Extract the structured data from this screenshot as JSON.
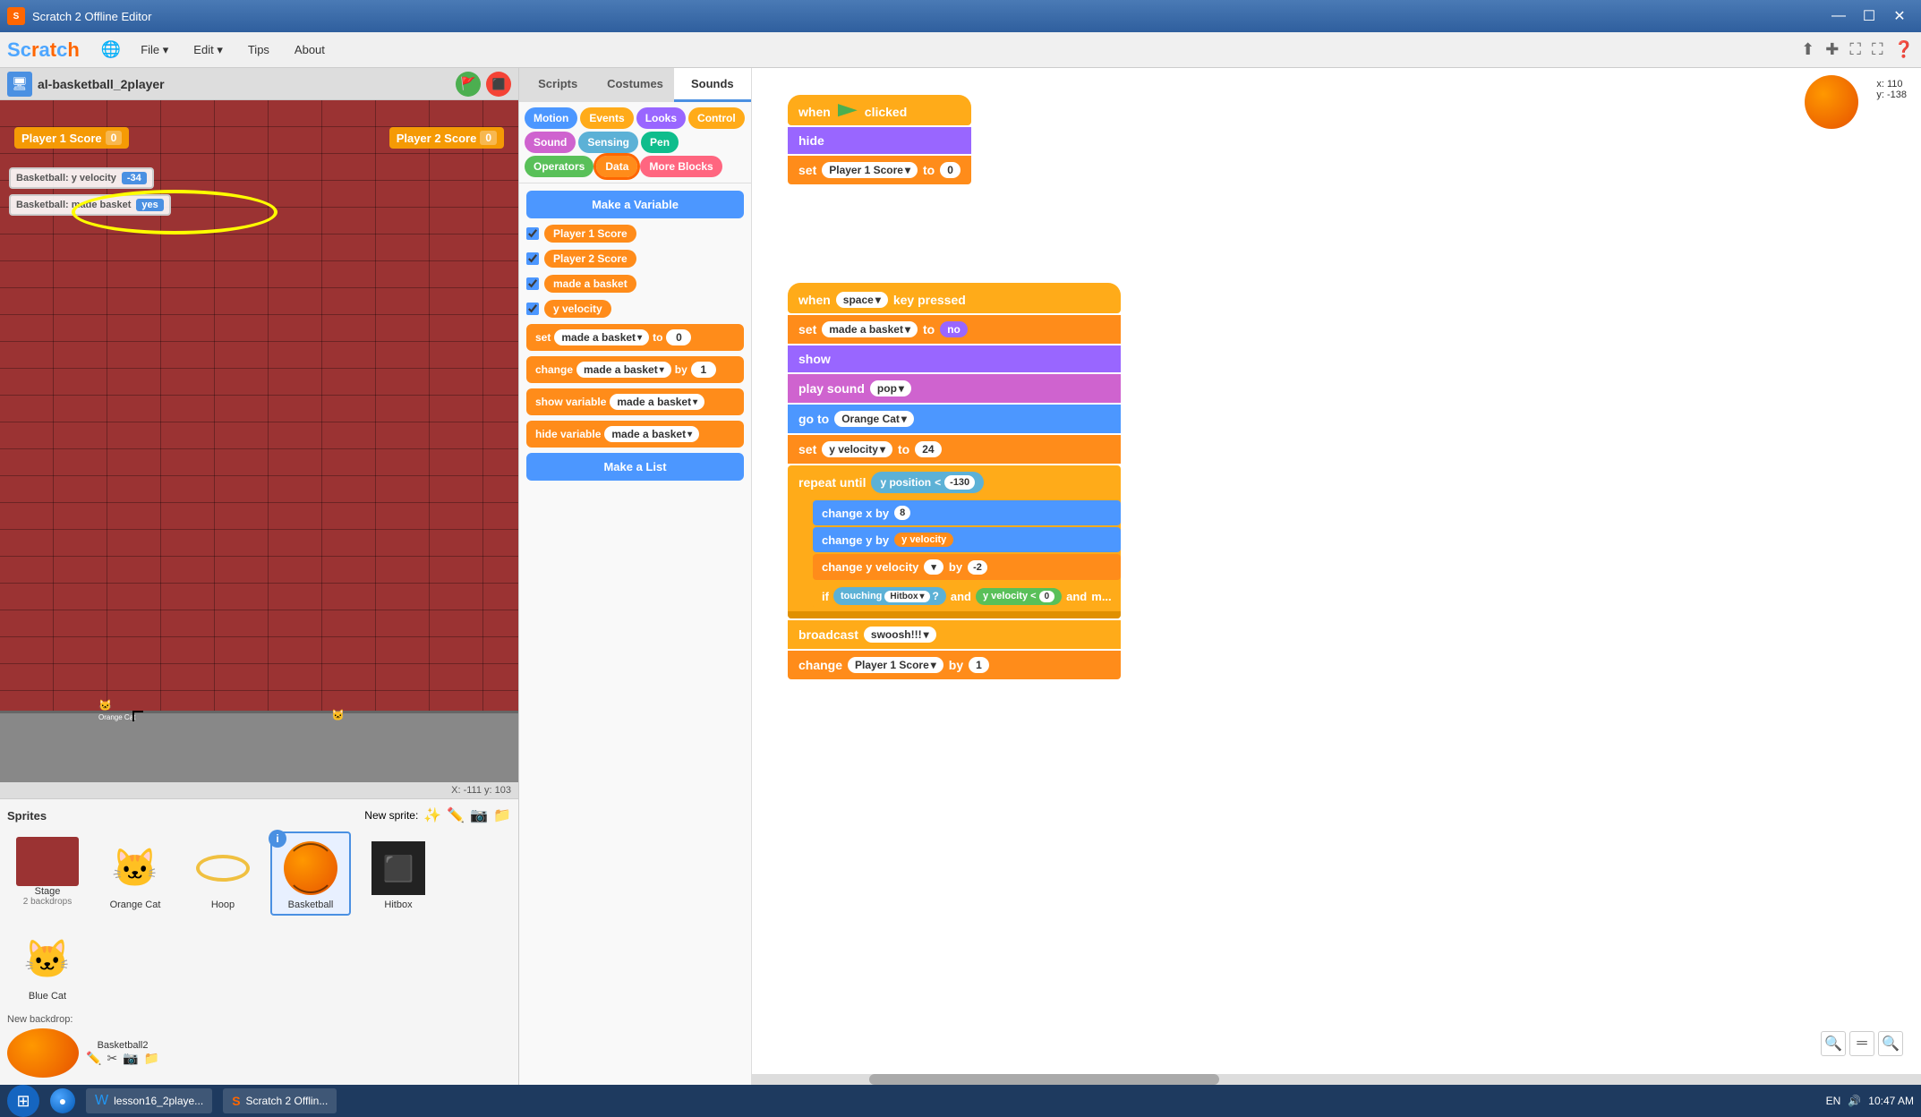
{
  "window": {
    "title": "Scratch 2 Offline Editor",
    "min_label": "—",
    "max_label": "☐",
    "close_label": "✕"
  },
  "menu": {
    "logo": "SCRATCH",
    "file": "File",
    "edit": "Edit",
    "tips": "Tips",
    "about": "About"
  },
  "project": {
    "name": "al-basketball_2player",
    "coords": "X: -111  y: 103"
  },
  "stage": {
    "player1_score_label": "Player 1 Score",
    "player1_score_val": "0",
    "player2_score_label": "Player 2 Score",
    "player2_score_val": "0",
    "var1_label": "Basketball: y velocity",
    "var1_val": "-34",
    "var2_label": "Basketball: made  basket",
    "var2_val": "yes",
    "coords": "X: -111  y: 103"
  },
  "tabs": {
    "scripts": "Scripts",
    "costumes": "Costumes",
    "sounds": "Sounds"
  },
  "categories": {
    "motion": "Motion",
    "looks": "Looks",
    "sound": "Sound",
    "pen": "Pen",
    "data": "Data",
    "events": "Events",
    "control": "Control",
    "sensing": "Sensing",
    "operators": "Operators",
    "more_blocks": "More Blocks"
  },
  "blocks_panel": {
    "make_variable": "Make a Variable",
    "make_list": "Make a List",
    "variables": [
      {
        "name": "Player 1 Score",
        "checked": true
      },
      {
        "name": "Player 2 Score",
        "checked": true
      },
      {
        "name": "made a basket",
        "checked": true
      },
      {
        "name": "y velocity",
        "checked": true
      }
    ],
    "set_var": "set",
    "set_var_name": "made a basket",
    "set_val": "0",
    "change_var": "change",
    "change_var_name": "made a basket",
    "change_by": "by",
    "change_val": "1",
    "show_var": "show variable",
    "show_var_name": "made a basket",
    "hide_var": "hide variable",
    "hide_var_name": "made a basket"
  },
  "script_blocks": {
    "when_clicked": "when",
    "clicked_label": "clicked",
    "hide_label": "hide",
    "set_label": "set",
    "p1score_var": "Player 1 Score",
    "to_label": "to",
    "set_val": "0",
    "when_space": "when",
    "space_label": "space",
    "key_pressed": "key  pressed",
    "set2_var": "made a basket",
    "set2_val": "no",
    "show_label": "show",
    "play_sound": "play  sound",
    "sound_name": "pop",
    "go_to": "go to",
    "go_target": "Orange Cat",
    "set_yvel": "set",
    "yvel_var": "y velocity",
    "yvel_to": "to",
    "yvel_val": "24",
    "repeat_until": "repeat  until",
    "y_position": "y position",
    "lt_label": "<",
    "pos_val": "-130",
    "change_x": "change  x  by",
    "x_val": "8",
    "change_y": "change  y  by",
    "y_vel_chip": "y velocity",
    "change_yvel": "change  y velocity",
    "change_yvel_by": "by",
    "yvel_change_val": "-2",
    "if_label": "if",
    "touching": "touching",
    "hitbox_var": "Hitbox",
    "and_label": "and",
    "yvel_label": "y velocity",
    "lt2": "<",
    "zero_val": "0",
    "and2": "and",
    "more_dots": "m...",
    "broadcast": "broadcast",
    "swoosh": "swoosh!!!",
    "change_p1": "change",
    "p1_var": "Player 1 Score",
    "change_by_1": "by",
    "p1_val": "1"
  },
  "sprites": {
    "title": "Sprites",
    "new_sprite": "New sprite:",
    "stage_label": "Stage",
    "stage_sublabel": "2 backdrops",
    "new_backdrop_label": "New backdrop:",
    "list": [
      {
        "name": "Orange Cat",
        "type": "cat-orange",
        "active": false
      },
      {
        "name": "Hoop",
        "type": "hoop",
        "active": false
      },
      {
        "name": "Basketball",
        "type": "basketball",
        "active": true
      },
      {
        "name": "Hitbox",
        "type": "hitbox",
        "active": false
      },
      {
        "name": "Blue Cat",
        "type": "cat-blue",
        "active": false
      }
    ],
    "extra": [
      {
        "name": "Basketball2",
        "type": "basketball-small"
      }
    ]
  },
  "taskbar": {
    "start_icon": "⊞",
    "chrome_icon": "●",
    "word_label": "lesson16_2playe...",
    "scratch_label": "Scratch 2 Offlin...",
    "lang": "EN",
    "time": "10:47 AM"
  },
  "coord_display": {
    "x": "x: 110",
    "y": "y: -138"
  }
}
